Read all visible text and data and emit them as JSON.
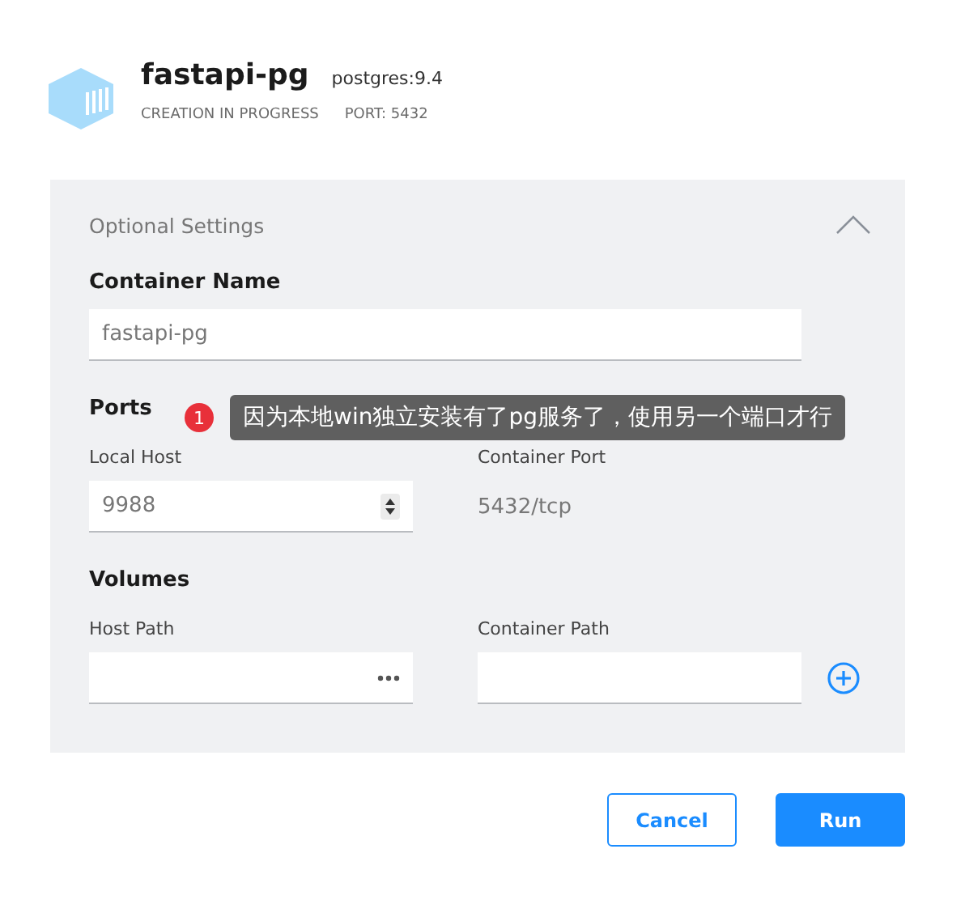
{
  "header": {
    "name": "fastapi-pg",
    "image": "postgres:9.4",
    "status": "CREATION IN PROGRESS",
    "port": "PORT: 5432"
  },
  "settings": {
    "title": "Optional Settings",
    "expanded": true,
    "container_name": {
      "label": "Container Name",
      "value": "fastapi-pg"
    },
    "ports": {
      "title": "Ports",
      "host_label": "Local Host",
      "container_label": "Container Port",
      "host_value": "9988",
      "container_value": "5432/tcp"
    },
    "volumes": {
      "title": "Volumes",
      "host_label": "Host Path",
      "container_label": "Container Path"
    }
  },
  "annotation": {
    "number": "1",
    "text": "因为本地win独立安装有了pg服务了，使用另一个端口才行"
  },
  "buttons": [
    {
      "label": "Cancel",
      "kind": "secondary"
    },
    {
      "label": "Run",
      "kind": "primary"
    }
  ]
}
